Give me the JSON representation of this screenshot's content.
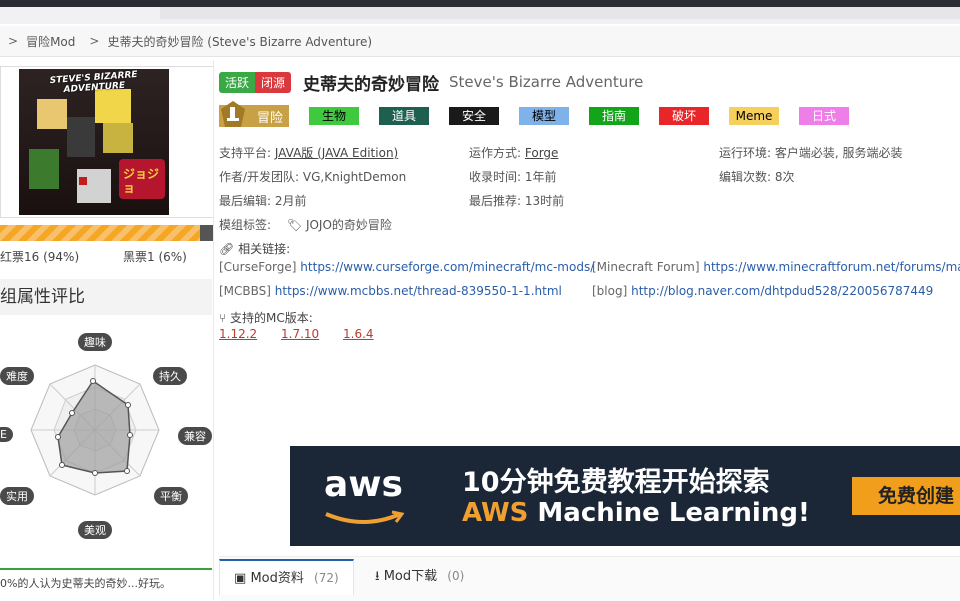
{
  "breadcrumb": {
    "items": [
      "冒险Mod",
      "史蒂夫的奇妙冒险 (Steve's Bizarre Adventure)"
    ]
  },
  "cover": {
    "logo_text": "STEVE'S BIZARRE ADVENTURE"
  },
  "votes": {
    "red": "红票16 (94%)",
    "black": "黑票1 (6%)",
    "red_fraction": 0.94
  },
  "attributes": {
    "heading": "组属性评比",
    "labels": [
      "趣味",
      "持久",
      "兼容",
      "平衡",
      "美观",
      "实用",
      "难度"
    ],
    "left_cut_label": "E"
  },
  "summary": "0%的人认为史蒂夫的奇妙...好玩。",
  "mod": {
    "status_active": "活跃",
    "status_closed": "闭源",
    "title": "史蒂夫的奇妙冒险",
    "title_en": "Steve's Bizarre Adventure",
    "category_main": "冒险",
    "categories": [
      {
        "label": "生物",
        "bg": "#3ec93e",
        "fg": "#000000"
      },
      {
        "label": "道具",
        "bg": "#1f5f4f",
        "fg": "#ffffff"
      },
      {
        "label": "安全",
        "bg": "#1a1a1a",
        "fg": "#ffffff"
      },
      {
        "label": "模型",
        "bg": "#7fb2e8",
        "fg": "#000000"
      },
      {
        "label": "指南",
        "bg": "#12a51a",
        "fg": "#ffffff"
      },
      {
        "label": "破坏",
        "bg": "#e8262a",
        "fg": "#ffffff"
      },
      {
        "label": "Meme",
        "bg": "#f6d05c",
        "fg": "#000000"
      },
      {
        "label": "日式",
        "bg": "#ee7ee8",
        "fg": "#ffffff"
      }
    ]
  },
  "info": {
    "platform_label": "支持平台:",
    "platform_value": "JAVA版 (JAVA Edition)",
    "runtime_label": "运作方式:",
    "runtime_value": "Forge",
    "env_label": "运行环境:",
    "env_value": "客户端必装, 服务端必装",
    "author_label": "作者/开发团队:",
    "author_value": "VG,KnightDemon",
    "added_label": "收录时间:",
    "added_value": "1年前",
    "edits_label": "编辑次数:",
    "edits_value": "8次",
    "lastedit_label": "最后编辑:",
    "lastedit_value": "2月前",
    "lastrec_label": "最后推荐:",
    "lastrec_value": "13时前",
    "tags_label": "模组标签:",
    "tags_value": "JOJO的奇妙冒险"
  },
  "links": {
    "heading": "相关链接:",
    "items": [
      {
        "site": "[CurseForge]",
        "url": "https://www.curseforge.com/minecraft/mc-mods/"
      },
      {
        "site": "[Minecraft Forum]",
        "url": "https://www.minecraftforum.net/forums/ma"
      },
      {
        "site": "[MCBBS]",
        "url": "https://www.mcbbs.net/thread-839550-1-1.html"
      },
      {
        "site": "[blog]",
        "url": "http://blog.naver.com/dhtpdud528/220056787449"
      }
    ]
  },
  "versions": {
    "heading": "支持的MC版本:",
    "items": [
      "1.12.2",
      "1.7.10",
      "1.6.4"
    ]
  },
  "ad": {
    "brand": "aws",
    "line1": "10分钟免费教程开始探索",
    "line2_prefix": "AWS",
    "line2_rest": " Machine Learning!",
    "cta": "免费创建"
  },
  "tabs": [
    {
      "label": "Mod资料",
      "count": "(72)"
    },
    {
      "label": "Mod下载",
      "count": "(0)"
    }
  ]
}
